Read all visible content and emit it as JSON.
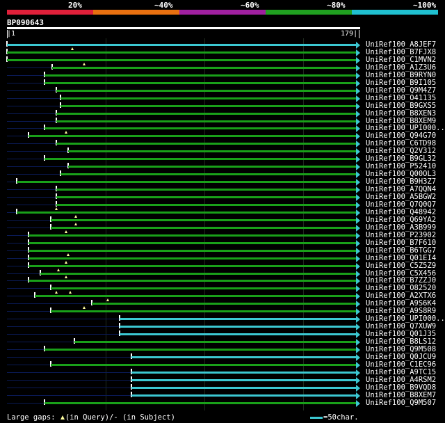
{
  "legend": {
    "labels": [
      "20%",
      "~40%",
      "~60%",
      "~80%",
      "~100%"
    ],
    "colors": [
      "#e0203a",
      "#e87010",
      "#a020a0",
      "#20a020",
      "#20c0d0"
    ]
  },
  "query": {
    "name": "BP090643",
    "start": "1",
    "end": "179"
  },
  "hits": [
    {
      "label": "UniRef100_A8JEF7",
      "color": "cyan",
      "start": 1,
      "gaps": []
    },
    {
      "label": "UniRef100_B7FJX8",
      "color": "green",
      "start": 1,
      "gaps": [
        34
      ]
    },
    {
      "label": "UniRef100_C1MVN2",
      "color": "green",
      "start": 1,
      "gaps": []
    },
    {
      "label": "UniRef100_A1Z3U6",
      "color": "green",
      "start": 24,
      "gaps": [
        40
      ]
    },
    {
      "label": "UniRef100_B9RYN0",
      "color": "green",
      "start": 20,
      "gaps": []
    },
    {
      "label": "UniRef100_B9I105",
      "color": "green",
      "start": 20,
      "gaps": []
    },
    {
      "label": "UniRef100_Q9M4Z7",
      "color": "green",
      "start": 26,
      "gaps": []
    },
    {
      "label": "UniRef100_O41135",
      "color": "green",
      "start": 28,
      "gaps": []
    },
    {
      "label": "UniRef100_B9GXS5",
      "color": "green",
      "start": 28,
      "gaps": []
    },
    {
      "label": "UniRef100_B8XEN3",
      "color": "green",
      "start": 26,
      "gaps": []
    },
    {
      "label": "UniRef100_B8XEM9",
      "color": "green",
      "start": 26,
      "gaps": []
    },
    {
      "label": "UniRef100_UPI000..",
      "color": "green",
      "start": 20,
      "gaps": []
    },
    {
      "label": "UniRef100_Q94G70",
      "color": "green",
      "start": 12,
      "gaps": [
        31
      ]
    },
    {
      "label": "UniRef100_C6TD98",
      "color": "green",
      "start": 26,
      "gaps": []
    },
    {
      "label": "UniRef100_Q2V312",
      "color": "green",
      "start": 32,
      "gaps": []
    },
    {
      "label": "UniRef100_B9GL32",
      "color": "green",
      "start": 20,
      "gaps": []
    },
    {
      "label": "UniRef100_P52410",
      "color": "green",
      "start": 32,
      "gaps": []
    },
    {
      "label": "UniRef100_Q00OL3",
      "color": "green",
      "start": 28,
      "gaps": []
    },
    {
      "label": "UniRef100_B9H3Z7",
      "color": "green",
      "start": 6,
      "gaps": []
    },
    {
      "label": "UniRef100_A7QQN4",
      "color": "green",
      "start": 26,
      "gaps": []
    },
    {
      "label": "UniRef100_A5BGW2",
      "color": "green",
      "start": 26,
      "gaps": []
    },
    {
      "label": "UniRef100_Q7Q0Q7",
      "color": "green",
      "start": 26,
      "gaps": []
    },
    {
      "label": "UniRef100_Q48942",
      "color": "green",
      "start": 6,
      "gaps": [
        26
      ]
    },
    {
      "label": "UniRef100_Q69YA2",
      "color": "green",
      "start": 23,
      "gaps": [
        36
      ]
    },
    {
      "label": "UniRef100_A3B999",
      "color": "green",
      "start": 23,
      "gaps": [
        36
      ]
    },
    {
      "label": "UniRef100_P23902",
      "color": "green",
      "start": 12,
      "gaps": [
        31
      ]
    },
    {
      "label": "UniRef100_B7F610",
      "color": "green",
      "start": 12,
      "gaps": []
    },
    {
      "label": "UniRef100_B6TGG7",
      "color": "green",
      "start": 12,
      "gaps": []
    },
    {
      "label": "UniRef100_Q01EI4",
      "color": "green",
      "start": 12,
      "gaps": [
        32
      ]
    },
    {
      "label": "UniRef100_C5Z5Z9",
      "color": "green",
      "start": 12,
      "gaps": [
        31
      ]
    },
    {
      "label": "UniRef100_C5X456",
      "color": "green",
      "start": 18,
      "gaps": [
        27
      ]
    },
    {
      "label": "UniRef100_B7ZZJ0",
      "color": "green",
      "start": 12,
      "gaps": [
        31
      ]
    },
    {
      "label": "UniRef100_O82520",
      "color": "green",
      "start": 23,
      "gaps": []
    },
    {
      "label": "UniRef100_A2XTX6",
      "color": "green",
      "start": 15,
      "gaps": [
        26,
        33
      ]
    },
    {
      "label": "UniRef100_A9S6K4",
      "color": "green",
      "start": 44,
      "gaps": [
        52
      ]
    },
    {
      "label": "UniRef100_A9S8R9",
      "color": "green",
      "start": 23,
      "gaps": [
        40
      ]
    },
    {
      "label": "UniRef100_UPI000..",
      "color": "cyan",
      "start": 58,
      "gaps": []
    },
    {
      "label": "UniRef100_Q7XUW9",
      "color": "cyan",
      "start": 58,
      "gaps": []
    },
    {
      "label": "UniRef100_Q01J35",
      "color": "cyan",
      "start": 58,
      "gaps": []
    },
    {
      "label": "UniRef100_B8LS12",
      "color": "green",
      "start": 35,
      "gaps": []
    },
    {
      "label": "UniRef100_Q9M508",
      "color": "green",
      "start": 20,
      "gaps": []
    },
    {
      "label": "UniRef100_Q0JCU9",
      "color": "cyan",
      "start": 64,
      "gaps": []
    },
    {
      "label": "UniRef100_C1EC96",
      "color": "green",
      "start": 23,
      "gaps": []
    },
    {
      "label": "UniRef100_A9TC15",
      "color": "cyan",
      "start": 64,
      "gaps": []
    },
    {
      "label": "UniRef100_A4RSM2",
      "color": "cyan",
      "start": 64,
      "gaps": []
    },
    {
      "label": "UniRef100_B9VQD8",
      "color": "cyan",
      "start": 64,
      "gaps": []
    },
    {
      "label": "UniRef100_B8XEM7",
      "color": "cyan",
      "start": 64,
      "gaps": []
    },
    {
      "label": "UniRef100_Q9M507",
      "color": "green",
      "start": 20,
      "gaps": []
    }
  ],
  "footer": {
    "gaps_label": "Large gaps:",
    "query_text": "(in Query)/",
    "subject_text": "- (in Subject)",
    "scale_text": "=50char."
  }
}
